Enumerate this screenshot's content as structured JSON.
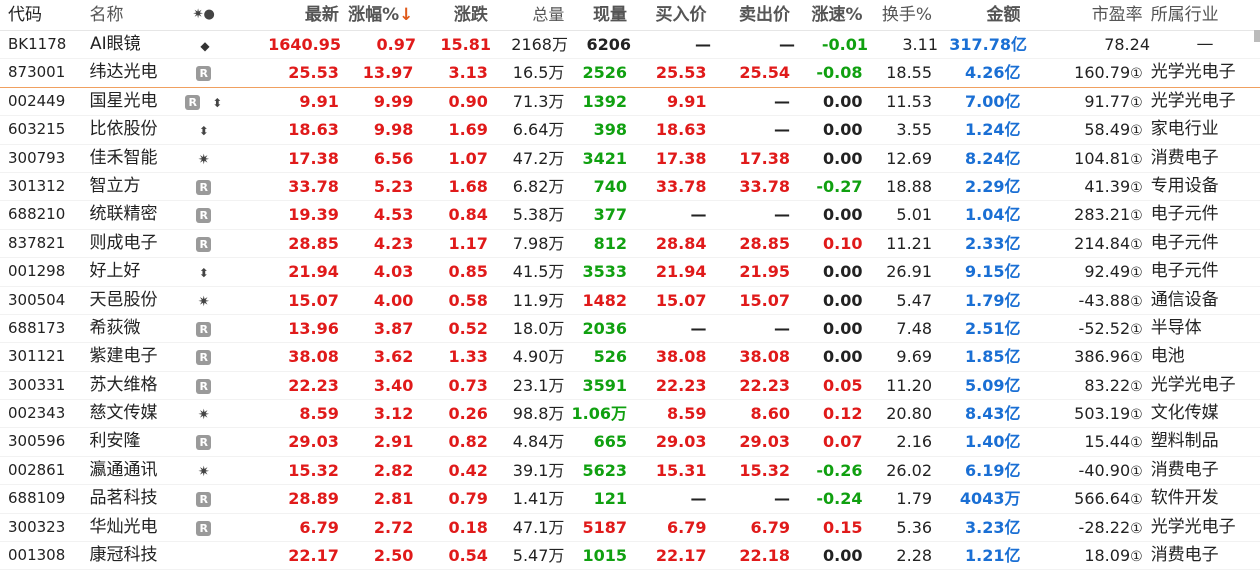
{
  "header": {
    "code": "代码",
    "name": "名称",
    "flag": "✷●",
    "last": "最新",
    "pct": "涨幅%",
    "pct_sort": "↓",
    "chg": "涨跌",
    "vol": "总量",
    "cur": "现量",
    "bid": "买入价",
    "ask": "卖出价",
    "spd": "涨速%",
    "turn": "换手%",
    "amt": "金额",
    "pe": "市盈率",
    "ind": "所属行业"
  },
  "colors": {
    "up": "#e01a1a",
    "down": "#10a010",
    "amount": "#1a6fd4",
    "selected_border": "#f0a060"
  },
  "rows": [
    {
      "code": "BK1178",
      "name": "AI眼镜",
      "flag": "◆",
      "flag_icon": "diamond-icon",
      "last": "1640.95",
      "last_c": "up",
      "pct": "0.97",
      "pct_c": "up",
      "chg": "15.81",
      "chg_c": "up",
      "vol": "2168万",
      "cur": "6206",
      "cur_c": "dark",
      "bid": "—",
      "bid_c": "dark",
      "ask": "—",
      "ask_c": "dark",
      "spd": "-0.01",
      "spd_c": "dn",
      "turn": "3.11",
      "amt": "317.78亿",
      "pe": "78.24",
      "pe_circ": "",
      "ind": "—",
      "ind_center": true
    },
    {
      "code": "873001",
      "name": "纬达光电",
      "flag": "R",
      "flag_icon": "r-badge",
      "last": "25.53",
      "last_c": "up",
      "pct": "13.97",
      "pct_c": "up",
      "chg": "3.13",
      "chg_c": "up",
      "vol": "16.5万",
      "cur": "2526",
      "cur_c": "dn",
      "bid": "25.53",
      "bid_c": "up",
      "ask": "25.54",
      "ask_c": "up",
      "spd": "-0.08",
      "spd_c": "dn",
      "turn": "18.55",
      "amt": "4.26亿",
      "pe": "160.79",
      "pe_circ": "①",
      "ind": "光学光电子",
      "selected": true
    },
    {
      "code": "002449",
      "name": "国星光电",
      "flag": "R",
      "flag_icon": "r-badge",
      "flag2": "⬍",
      "last": "9.91",
      "last_c": "up",
      "pct": "9.99",
      "pct_c": "up",
      "chg": "0.90",
      "chg_c": "up",
      "vol": "71.3万",
      "cur": "1392",
      "cur_c": "dn",
      "bid": "9.91",
      "bid_c": "up",
      "ask": "—",
      "ask_c": "dark",
      "spd": "0.00",
      "spd_c": "flat",
      "turn": "11.53",
      "amt": "7.00亿",
      "pe": "91.77",
      "pe_circ": "①",
      "ind": "光学光电子"
    },
    {
      "code": "603215",
      "name": "比依股份",
      "flag": "⬍",
      "flag_icon": "updown-icon",
      "last": "18.63",
      "last_c": "up",
      "pct": "9.98",
      "pct_c": "up",
      "chg": "1.69",
      "chg_c": "up",
      "vol": "6.64万",
      "cur": "398",
      "cur_c": "dn",
      "bid": "18.63",
      "bid_c": "up",
      "ask": "—",
      "ask_c": "dark",
      "spd": "0.00",
      "spd_c": "flat",
      "turn": "3.55",
      "amt": "1.24亿",
      "pe": "58.49",
      "pe_circ": "①",
      "ind": "家电行业"
    },
    {
      "code": "300793",
      "name": "佳禾智能",
      "flag": "✷",
      "flag_icon": "star-icon",
      "last": "17.38",
      "last_c": "up",
      "pct": "6.56",
      "pct_c": "up",
      "chg": "1.07",
      "chg_c": "up",
      "vol": "47.2万",
      "cur": "3421",
      "cur_c": "dn",
      "bid": "17.38",
      "bid_c": "up",
      "ask": "17.38",
      "ask_c": "up",
      "spd": "0.00",
      "spd_c": "flat",
      "turn": "12.69",
      "amt": "8.24亿",
      "pe": "104.81",
      "pe_circ": "①",
      "ind": "消费电子"
    },
    {
      "code": "301312",
      "name": "智立方",
      "flag": "R",
      "flag_icon": "r-badge",
      "last": "33.78",
      "last_c": "up",
      "pct": "5.23",
      "pct_c": "up",
      "chg": "1.68",
      "chg_c": "up",
      "vol": "6.82万",
      "cur": "740",
      "cur_c": "dn",
      "bid": "33.78",
      "bid_c": "up",
      "ask": "33.78",
      "ask_c": "up",
      "spd": "-0.27",
      "spd_c": "dn",
      "turn": "18.88",
      "amt": "2.29亿",
      "pe": "41.39",
      "pe_circ": "①",
      "ind": "专用设备"
    },
    {
      "code": "688210",
      "name": "统联精密",
      "flag": "R",
      "flag_icon": "r-badge",
      "last": "19.39",
      "last_c": "up",
      "pct": "4.53",
      "pct_c": "up",
      "chg": "0.84",
      "chg_c": "up",
      "vol": "5.38万",
      "cur": "377",
      "cur_c": "dn",
      "bid": "—",
      "bid_c": "dark",
      "ask": "—",
      "ask_c": "dark",
      "spd": "0.00",
      "spd_c": "flat",
      "turn": "5.01",
      "amt": "1.04亿",
      "pe": "283.21",
      "pe_circ": "①",
      "ind": "电子元件"
    },
    {
      "code": "837821",
      "name": "则成电子",
      "flag": "R",
      "flag_icon": "r-badge",
      "last": "28.85",
      "last_c": "up",
      "pct": "4.23",
      "pct_c": "up",
      "chg": "1.17",
      "chg_c": "up",
      "vol": "7.98万",
      "cur": "812",
      "cur_c": "dn",
      "bid": "28.84",
      "bid_c": "up",
      "ask": "28.85",
      "ask_c": "up",
      "spd": "0.10",
      "spd_c": "up",
      "turn": "11.21",
      "amt": "2.33亿",
      "pe": "214.84",
      "pe_circ": "①",
      "ind": "电子元件"
    },
    {
      "code": "001298",
      "name": "好上好",
      "flag": "⬍",
      "flag_icon": "updown-icon",
      "last": "21.94",
      "last_c": "up",
      "pct": "4.03",
      "pct_c": "up",
      "chg": "0.85",
      "chg_c": "up",
      "vol": "41.5万",
      "cur": "3533",
      "cur_c": "dn",
      "bid": "21.94",
      "bid_c": "up",
      "ask": "21.95",
      "ask_c": "up",
      "spd": "0.00",
      "spd_c": "flat",
      "turn": "26.91",
      "amt": "9.15亿",
      "pe": "92.49",
      "pe_circ": "①",
      "ind": "电子元件"
    },
    {
      "code": "300504",
      "name": "天邑股份",
      "flag": "✷",
      "flag_icon": "star-icon",
      "last": "15.07",
      "last_c": "up",
      "pct": "4.00",
      "pct_c": "up",
      "chg": "0.58",
      "chg_c": "up",
      "vol": "11.9万",
      "cur": "1482",
      "cur_c": "up",
      "bid": "15.07",
      "bid_c": "up",
      "ask": "15.07",
      "ask_c": "up",
      "spd": "0.00",
      "spd_c": "flat",
      "turn": "5.47",
      "amt": "1.79亿",
      "pe": "-43.88",
      "pe_circ": "①",
      "ind": "通信设备"
    },
    {
      "code": "688173",
      "name": "希荻微",
      "flag": "R",
      "flag_icon": "r-badge",
      "last": "13.96",
      "last_c": "up",
      "pct": "3.87",
      "pct_c": "up",
      "chg": "0.52",
      "chg_c": "up",
      "vol": "18.0万",
      "cur": "2036",
      "cur_c": "dn",
      "bid": "—",
      "bid_c": "dark",
      "ask": "—",
      "ask_c": "dark",
      "spd": "0.00",
      "spd_c": "flat",
      "turn": "7.48",
      "amt": "2.51亿",
      "pe": "-52.52",
      "pe_circ": "①",
      "ind": "半导体"
    },
    {
      "code": "301121",
      "name": "紫建电子",
      "flag": "R",
      "flag_icon": "r-badge",
      "last": "38.08",
      "last_c": "up",
      "pct": "3.62",
      "pct_c": "up",
      "chg": "1.33",
      "chg_c": "up",
      "vol": "4.90万",
      "cur": "526",
      "cur_c": "dn",
      "bid": "38.08",
      "bid_c": "up",
      "ask": "38.08",
      "ask_c": "up",
      "spd": "0.00",
      "spd_c": "flat",
      "turn": "9.69",
      "amt": "1.85亿",
      "pe": "386.96",
      "pe_circ": "①",
      "ind": "电池"
    },
    {
      "code": "300331",
      "name": "苏大维格",
      "flag": "R",
      "flag_icon": "r-badge",
      "last": "22.23",
      "last_c": "up",
      "pct": "3.40",
      "pct_c": "up",
      "chg": "0.73",
      "chg_c": "up",
      "vol": "23.1万",
      "cur": "3591",
      "cur_c": "dn",
      "bid": "22.23",
      "bid_c": "up",
      "ask": "22.23",
      "ask_c": "up",
      "spd": "0.05",
      "spd_c": "up",
      "turn": "11.20",
      "amt": "5.09亿",
      "pe": "83.22",
      "pe_circ": "①",
      "ind": "光学光电子"
    },
    {
      "code": "002343",
      "name": "慈文传媒",
      "flag": "✷",
      "flag_icon": "star-icon",
      "last": "8.59",
      "last_c": "up",
      "pct": "3.12",
      "pct_c": "up",
      "chg": "0.26",
      "chg_c": "up",
      "vol": "98.8万",
      "cur": "1.06万",
      "cur_c": "dn",
      "bid": "8.59",
      "bid_c": "up",
      "ask": "8.60",
      "ask_c": "up",
      "spd": "0.12",
      "spd_c": "up",
      "turn": "20.80",
      "amt": "8.43亿",
      "pe": "503.19",
      "pe_circ": "①",
      "ind": "文化传媒"
    },
    {
      "code": "300596",
      "name": "利安隆",
      "flag": "R",
      "flag_icon": "r-badge",
      "last": "29.03",
      "last_c": "up",
      "pct": "2.91",
      "pct_c": "up",
      "chg": "0.82",
      "chg_c": "up",
      "vol": "4.84万",
      "cur": "665",
      "cur_c": "dn",
      "bid": "29.03",
      "bid_c": "up",
      "ask": "29.03",
      "ask_c": "up",
      "spd": "0.07",
      "spd_c": "up",
      "turn": "2.16",
      "amt": "1.40亿",
      "pe": "15.44",
      "pe_circ": "①",
      "ind": "塑料制品"
    },
    {
      "code": "002861",
      "name": "瀛通通讯",
      "flag": "✷",
      "flag_icon": "star-icon",
      "last": "15.32",
      "last_c": "up",
      "pct": "2.82",
      "pct_c": "up",
      "chg": "0.42",
      "chg_c": "up",
      "vol": "39.1万",
      "cur": "5623",
      "cur_c": "dn",
      "bid": "15.31",
      "bid_c": "up",
      "ask": "15.32",
      "ask_c": "up",
      "spd": "-0.26",
      "spd_c": "dn",
      "turn": "26.02",
      "amt": "6.19亿",
      "pe": "-40.90",
      "pe_circ": "①",
      "ind": "消费电子"
    },
    {
      "code": "688109",
      "name": "品茗科技",
      "flag": "R",
      "flag_icon": "r-badge",
      "last": "28.89",
      "last_c": "up",
      "pct": "2.81",
      "pct_c": "up",
      "chg": "0.79",
      "chg_c": "up",
      "vol": "1.41万",
      "cur": "121",
      "cur_c": "dn",
      "bid": "—",
      "bid_c": "dark",
      "ask": "—",
      "ask_c": "dark",
      "spd": "-0.24",
      "spd_c": "dn",
      "turn": "1.79",
      "amt": "4043万",
      "pe": "566.64",
      "pe_circ": "①",
      "ind": "软件开发"
    },
    {
      "code": "300323",
      "name": "华灿光电",
      "flag": "R",
      "flag_icon": "r-badge",
      "last": "6.79",
      "last_c": "up",
      "pct": "2.72",
      "pct_c": "up",
      "chg": "0.18",
      "chg_c": "up",
      "vol": "47.1万",
      "cur": "5187",
      "cur_c": "up",
      "bid": "6.79",
      "bid_c": "up",
      "ask": "6.79",
      "ask_c": "up",
      "spd": "0.15",
      "spd_c": "up",
      "turn": "5.36",
      "amt": "3.23亿",
      "pe": "-28.22",
      "pe_circ": "①",
      "ind": "光学光电子"
    },
    {
      "code": "001308",
      "name": "康冠科技",
      "flag": "",
      "flag_icon": "",
      "last": "22.17",
      "last_c": "up",
      "pct": "2.50",
      "pct_c": "up",
      "chg": "0.54",
      "chg_c": "up",
      "vol": "5.47万",
      "cur": "1015",
      "cur_c": "dn",
      "bid": "22.17",
      "bid_c": "up",
      "ask": "22.18",
      "ask_c": "up",
      "spd": "0.00",
      "spd_c": "flat",
      "turn": "2.28",
      "amt": "1.21亿",
      "pe": "18.09",
      "pe_circ": "①",
      "ind": "消费电子"
    }
  ]
}
